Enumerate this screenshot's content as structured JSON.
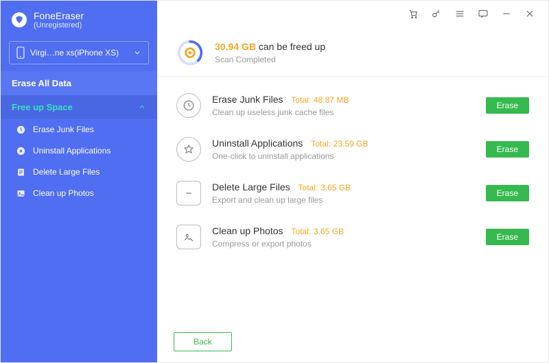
{
  "app": {
    "name": "FoneEraser",
    "status": "(Unregistered)"
  },
  "device": {
    "label": "Virgi…ne xs(iPhone XS)"
  },
  "sidebar": {
    "erase_all": "Erase All Data",
    "free_up": "Free up Space",
    "items": [
      {
        "label": "Erase Junk Files"
      },
      {
        "label": "Uninstall Applications"
      },
      {
        "label": "Delete Large Files"
      },
      {
        "label": "Clean up Photos"
      }
    ]
  },
  "summary": {
    "size": "30.94 GB",
    "tail": "can be freed up",
    "status": "Scan Completed"
  },
  "rows": [
    {
      "title": "Erase Junk Files",
      "total_label": "Total:",
      "total_value": "48.87 MB",
      "sub": "Clean up useless junk cache files",
      "action": "Erase"
    },
    {
      "title": "Uninstall Applications",
      "total_label": "Total:",
      "total_value": "23.59 GB",
      "sub": "One-click to uninstall applications",
      "action": "Erase"
    },
    {
      "title": "Delete Large Files",
      "total_label": "Total:",
      "total_value": "3.65 GB",
      "sub": "Export and clean up large files",
      "action": "Erase"
    },
    {
      "title": "Clean up Photos",
      "total_label": "Total:",
      "total_value": "3.65 GB",
      "sub": "Compress or export photos",
      "action": "Erase"
    }
  ],
  "footer": {
    "back": "Back"
  }
}
